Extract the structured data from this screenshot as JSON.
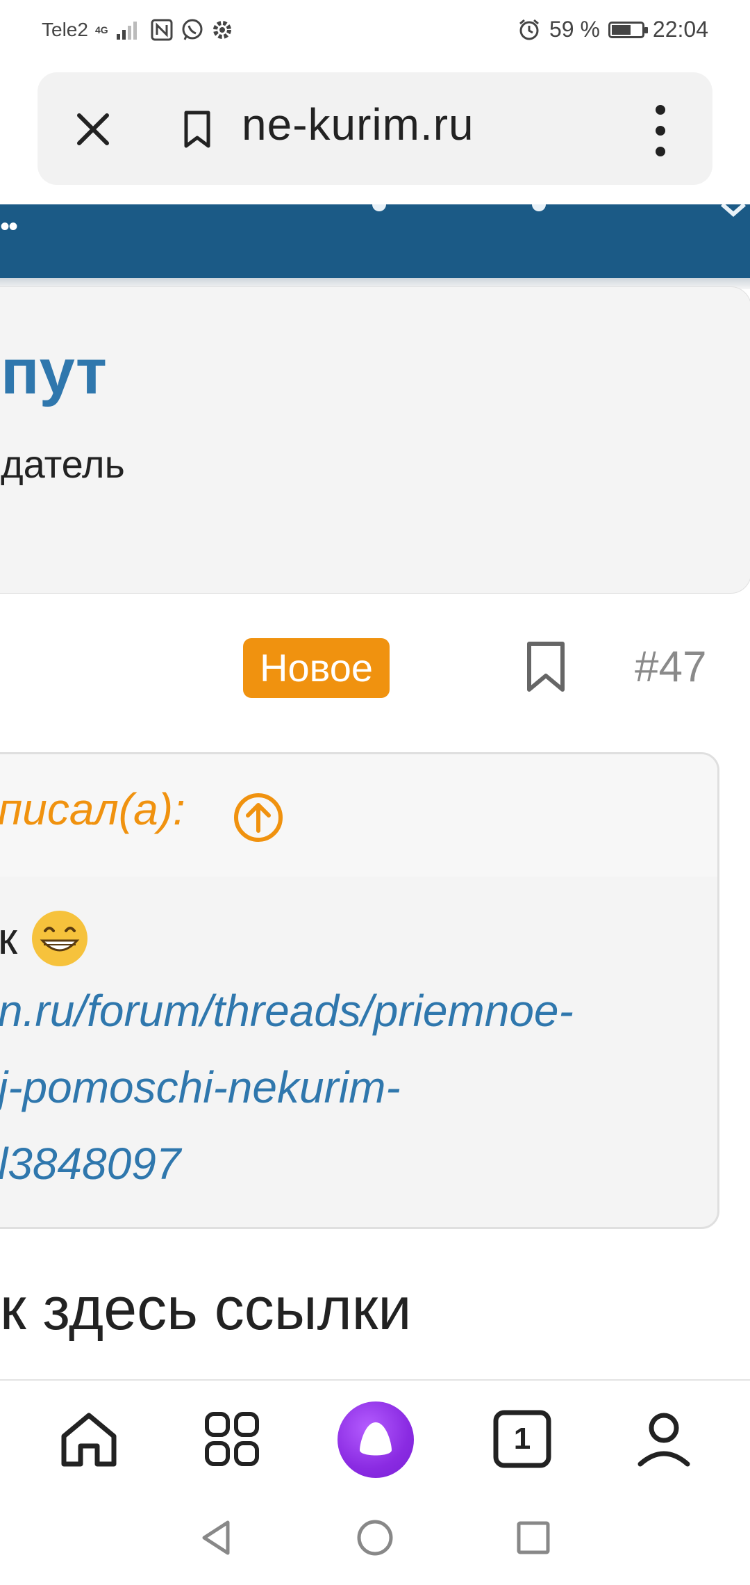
{
  "status_bar": {
    "carrier": "Tele2",
    "network": "4G",
    "battery_percent": "59 %",
    "battery_level": 0.59,
    "time": "22:04"
  },
  "url_bar": {
    "domain": "ne-kurim.ru",
    "close_icon": "close-icon",
    "bookmark_icon": "bookmark-icon",
    "menu_icon": "more-vert-icon"
  },
  "header": {
    "dots": "•• "
  },
  "profile": {
    "name": "пут",
    "role": "датель"
  },
  "post": {
    "badge": "Новое",
    "number": "#47"
  },
  "quote": {
    "attribution": "писал(а):",
    "line1_text": "к",
    "link_line1": "n.ru/forum/threads/priemnoe-",
    "link_line2": "j-pomoschi-nekurim-",
    "link_line3": "l3848097"
  },
  "body_text": "к здесь ссылки",
  "toolbar": {
    "tabs_count": "1"
  },
  "colors": {
    "header_blue": "#1b5a86",
    "link_blue": "#2f77ad",
    "accent_orange": "#f0920f",
    "alice_purple": "#8a2be2"
  }
}
